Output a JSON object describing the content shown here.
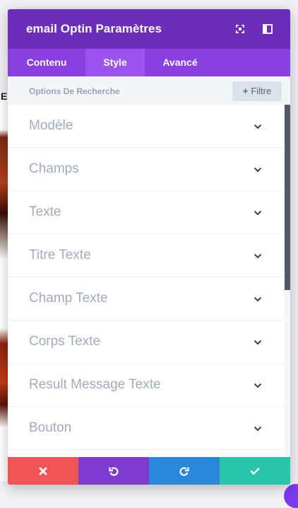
{
  "background": {
    "partial_text": "E"
  },
  "modal": {
    "title": "email Optin Paramètres",
    "header_icons": [
      "expand-icon",
      "split-view-icon"
    ]
  },
  "tabs": [
    {
      "label": "Contenu",
      "active": false
    },
    {
      "label": "Style",
      "active": true
    },
    {
      "label": "Avancé",
      "active": false
    }
  ],
  "search": {
    "placeholder": "Options De Recherche",
    "filter_label": "Filtre"
  },
  "sections": [
    {
      "label": "Modèle"
    },
    {
      "label": "Champs"
    },
    {
      "label": "Texte"
    },
    {
      "label": "Titre Texte"
    },
    {
      "label": "Champ Texte"
    },
    {
      "label": "Corps Texte"
    },
    {
      "label": "Result Message Texte"
    },
    {
      "label": "Bouton"
    }
  ],
  "footer": {
    "icons": [
      "close-icon",
      "undo-icon",
      "redo-icon",
      "check-icon"
    ]
  },
  "colors": {
    "header": "#6c2eb9",
    "tabs": "#8a3fe0",
    "active_tab": "#9b55ee",
    "cancel": "#ef5555",
    "undo": "#7e3bd0",
    "redo": "#2b87da",
    "save": "#29c4a9"
  }
}
